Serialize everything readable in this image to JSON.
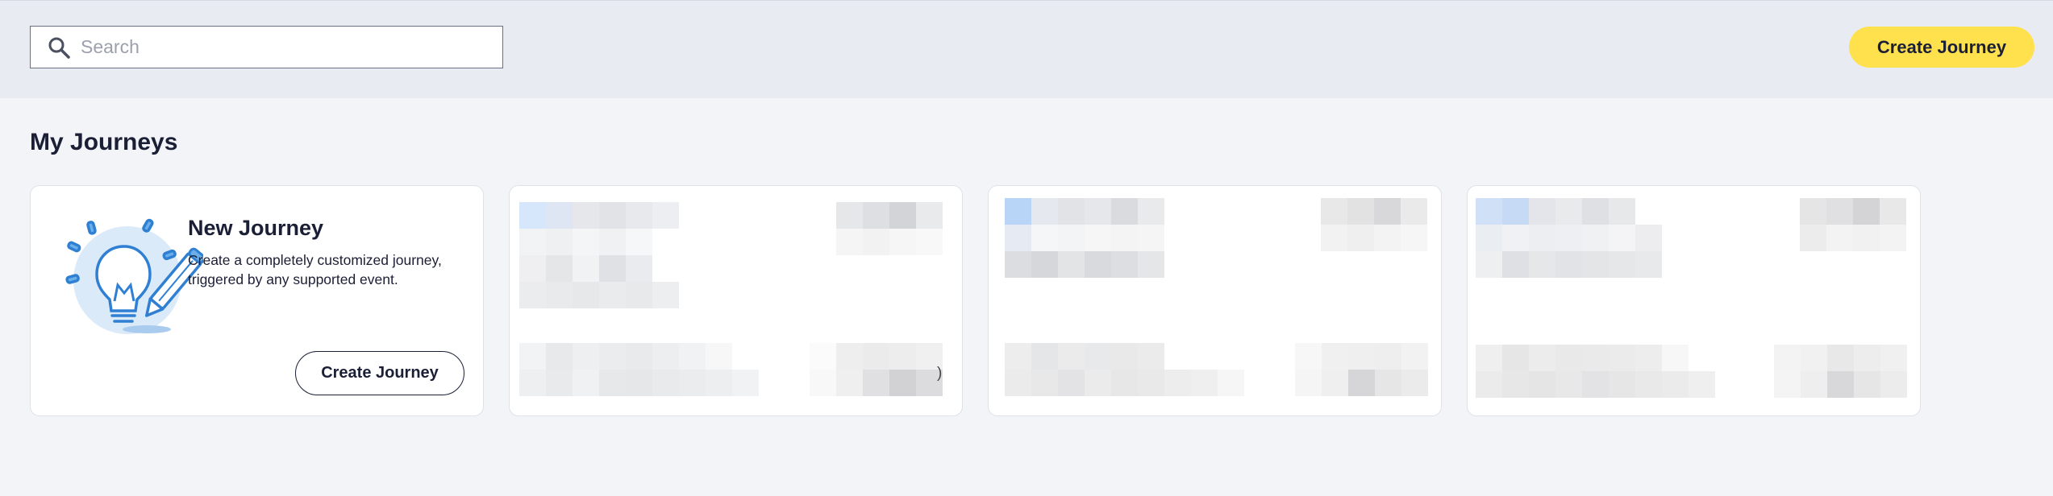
{
  "header": {
    "search": {
      "placeholder": "Search",
      "value": "",
      "icon": "search-icon"
    },
    "create_button_label": "Create Journey"
  },
  "main": {
    "section_title": "My Journeys",
    "new_journey_card": {
      "title": "New Journey",
      "description": "Create a completely customized journey, triggered by any supported event.",
      "button_label": "Create Journey",
      "icon": "lightbulb-pencil-icon"
    },
    "journey_cards": [
      {
        "content": "redacted"
      },
      {
        "content": "redacted",
        "stray_text": ")"
      },
      {
        "content": "redacted"
      }
    ]
  },
  "colors": {
    "page_background": "#f3f4f8",
    "header_background": "#e9ebf3",
    "primary_button": "#ffe14d",
    "text": "#1a1f36",
    "illustration_blue": "#2f7fd3",
    "illustration_bg": "#dbeaf8"
  }
}
